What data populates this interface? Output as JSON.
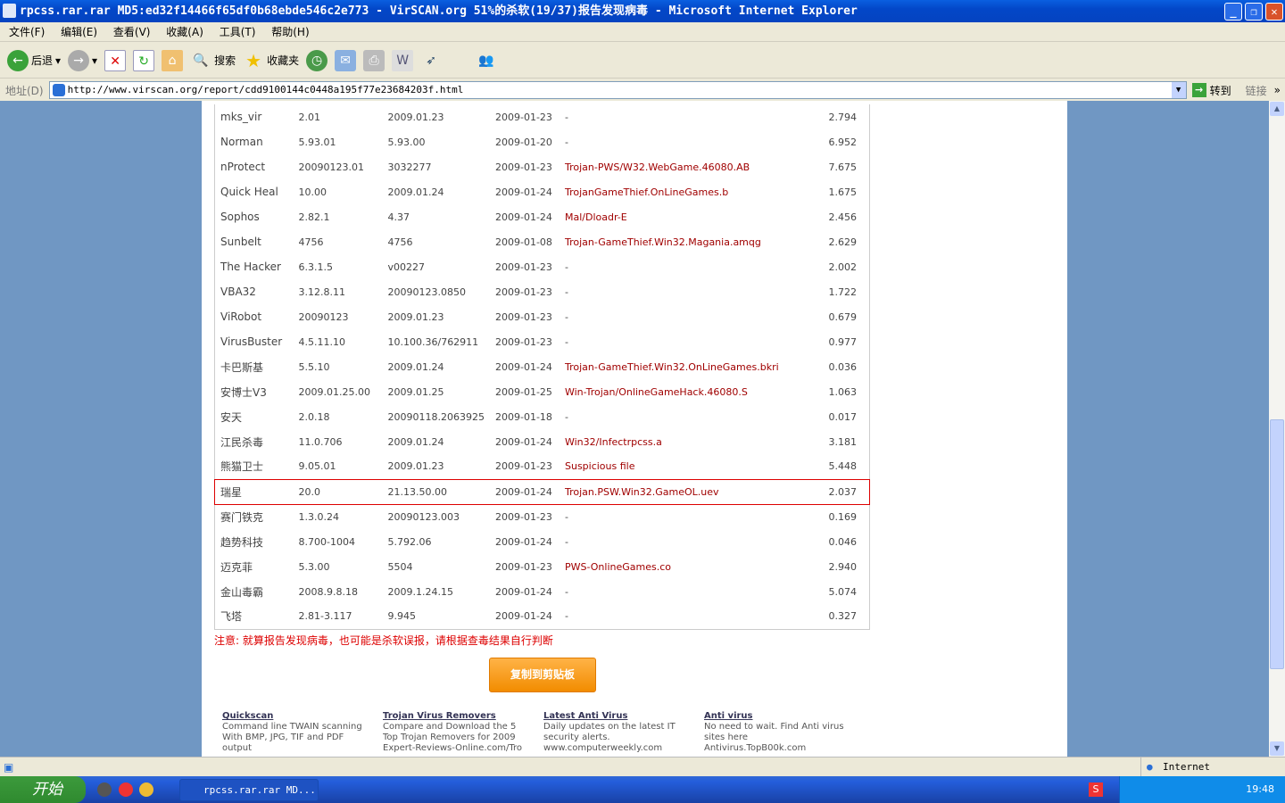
{
  "window": {
    "title": "rpcss.rar.rar MD5:ed32f14466f65df0b68ebde546c2e773 - VirSCAN.org 51%的杀软(19/37)报告发现病毒 - Microsoft Internet Explorer"
  },
  "menu": [
    "文件(F)",
    "编辑(E)",
    "查看(V)",
    "收藏(A)",
    "工具(T)",
    "帮助(H)"
  ],
  "toolbar": {
    "back": "后退",
    "search": "搜索",
    "favorites": "收藏夹"
  },
  "address": {
    "label": "地址(D)",
    "url": "http://www.virscan.org/report/cdd9100144c0448a195f77e23684203f.html",
    "go": "转到",
    "links": "链接"
  },
  "results": [
    [
      "mks_vir",
      "2.01",
      "2009.01.23",
      "2009-01-23",
      "-",
      "2.794"
    ],
    [
      "Norman",
      "5.93.01",
      "5.93.00",
      "2009-01-20",
      "-",
      "6.952"
    ],
    [
      "nProtect",
      "20090123.01",
      "3032277",
      "2009-01-23",
      "Trojan-PWS/W32.WebGame.46080.AB",
      "7.675"
    ],
    [
      "Quick Heal",
      "10.00",
      "2009.01.24",
      "2009-01-24",
      "TrojanGameThief.OnLineGames.b",
      "1.675"
    ],
    [
      "Sophos",
      "2.82.1",
      "4.37",
      "2009-01-24",
      "Mal/Dloadr-E",
      "2.456"
    ],
    [
      "Sunbelt",
      "4756",
      "4756",
      "2009-01-08",
      "Trojan-GameThief.Win32.Magania.amqg",
      "2.629"
    ],
    [
      "The Hacker",
      "6.3.1.5",
      "v00227",
      "2009-01-23",
      "-",
      "2.002"
    ],
    [
      "VBA32",
      "3.12.8.11",
      "20090123.0850",
      "2009-01-23",
      "-",
      "1.722"
    ],
    [
      "ViRobot",
      "20090123",
      "2009.01.23",
      "2009-01-23",
      "-",
      "0.679"
    ],
    [
      "VirusBuster",
      "4.5.11.10",
      "10.100.36/762911",
      "2009-01-23",
      "-",
      "0.977"
    ],
    [
      "卡巴斯基",
      "5.5.10",
      "2009.01.24",
      "2009-01-24",
      "Trojan-GameThief.Win32.OnLineGames.bkri",
      "0.036"
    ],
    [
      "安博士V3",
      "2009.01.25.00",
      "2009.01.25",
      "2009-01-25",
      "Win-Trojan/OnlineGameHack.46080.S",
      "1.063"
    ],
    [
      "安天",
      "2.0.18",
      "20090118.2063925",
      "2009-01-18",
      "-",
      "0.017"
    ],
    [
      "江民杀毒",
      "11.0.706",
      "2009.01.24",
      "2009-01-24",
      "Win32/Infectrpcss.a",
      "3.181"
    ],
    [
      "熊猫卫士",
      "9.05.01",
      "2009.01.23",
      "2009-01-23",
      "Suspicious file",
      "5.448"
    ],
    [
      "瑞星",
      "20.0",
      "21.13.50.00",
      "2009-01-24",
      "Trojan.PSW.Win32.GameOL.uev",
      "2.037"
    ],
    [
      "赛门铁克",
      "1.3.0.24",
      "20090123.003",
      "2009-01-23",
      "-",
      "0.169"
    ],
    [
      "趋势科技",
      "8.700-1004",
      "5.792.06",
      "2009-01-24",
      "-",
      "0.046"
    ],
    [
      "迈克菲",
      "5.3.00",
      "5504",
      "2009-01-23",
      "PWS-OnlineGames.co",
      "2.940"
    ],
    [
      "金山毒霸",
      "2008.9.8.18",
      "2009.1.24.15",
      "2009-01-24",
      "-",
      "5.074"
    ],
    [
      "飞塔",
      "2.81-3.117",
      "9.945",
      "2009-01-24",
      "-",
      "0.327"
    ]
  ],
  "highlight_index": 15,
  "note": "注意: 就算报告发现病毒，也可能是杀软误报，请根据查毒结果自行判断",
  "copy_button": "复制到剪贴板",
  "ads": [
    {
      "title": "Quickscan",
      "lines": [
        "Command line TWAIN scanning",
        "With BMP, JPG, TIF and PDF",
        "output"
      ]
    },
    {
      "title": "Trojan Virus Removers",
      "lines": [
        "Compare and Download the 5",
        "Top Trojan Removers for 2009",
        "Expert-Reviews-Online.com/Tro"
      ]
    },
    {
      "title": "Latest Anti Virus",
      "lines": [
        "Daily updates on the latest IT",
        "security alerts.",
        "www.computerweekly.com"
      ]
    },
    {
      "title": "Anti virus",
      "lines": [
        "No need to wait. Find Anti virus",
        "sites here",
        "Antivirus.TopB00k.com"
      ]
    }
  ],
  "status": {
    "zone": "Internet"
  },
  "taskbar": {
    "start": "开始",
    "task": "rpcss.rar.rar MD...",
    "clock": "19:48"
  }
}
